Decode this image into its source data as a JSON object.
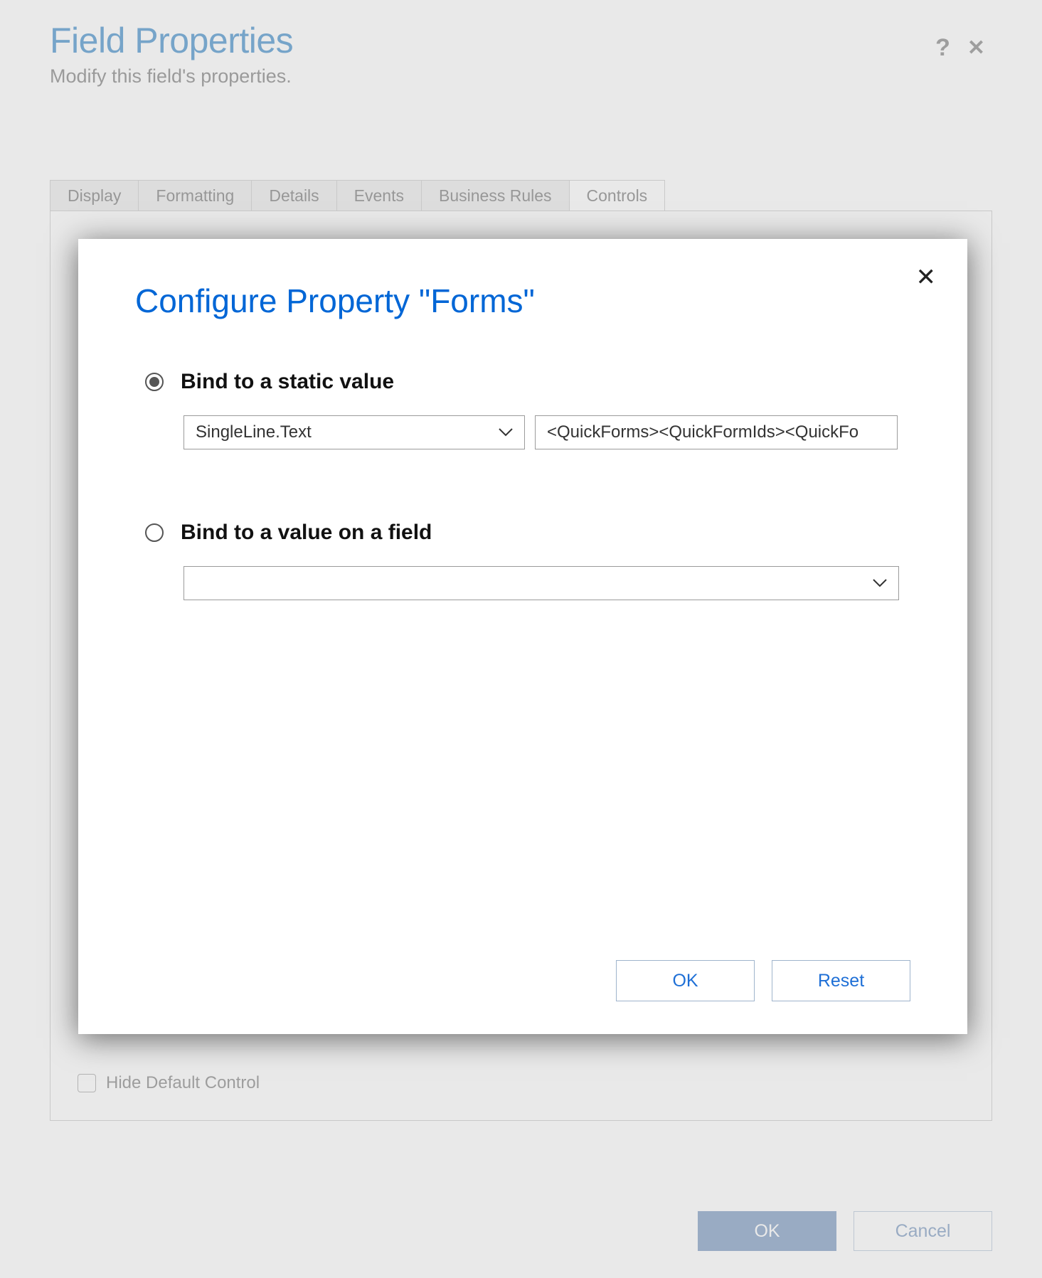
{
  "main": {
    "title": "Field Properties",
    "subtitle": "Modify this field's properties.",
    "tabs": [
      {
        "label": "Display"
      },
      {
        "label": "Formatting"
      },
      {
        "label": "Details"
      },
      {
        "label": "Events"
      },
      {
        "label": "Business Rules"
      },
      {
        "label": "Controls",
        "active": true
      }
    ],
    "hide_default_control_label": "Hide Default Control",
    "ok_label": "OK",
    "cancel_label": "Cancel"
  },
  "modal": {
    "title": "Configure Property \"Forms\"",
    "option_static_label": "Bind to a static value",
    "static_type_value": "SingleLine.Text",
    "static_value_text": "<QuickForms><QuickFormIds><QuickFo",
    "option_field_label": "Bind to a value on a field",
    "field_value": "",
    "ok_label": "OK",
    "reset_label": "Reset"
  }
}
